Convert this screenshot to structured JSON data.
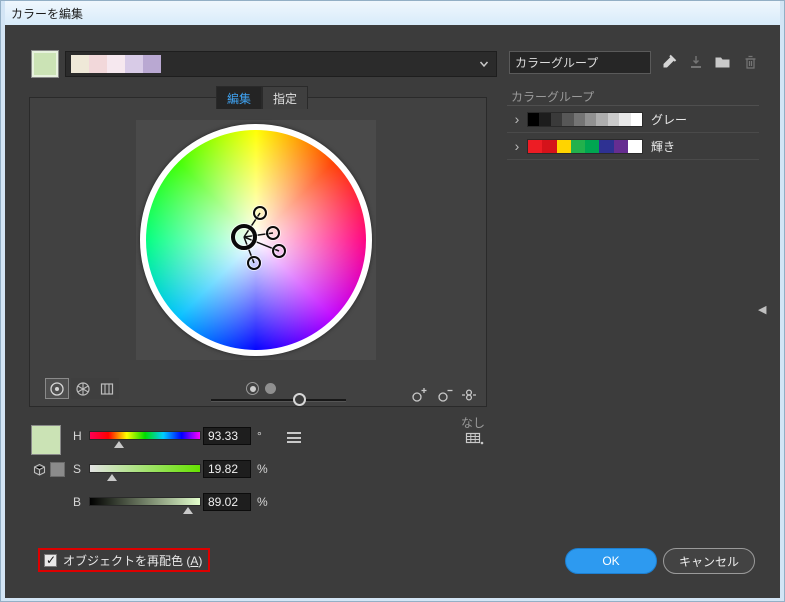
{
  "window": {
    "title": "カラーを編集"
  },
  "top": {
    "base_color": "#cbe3b5",
    "preview_colors": [
      "#efe9d8",
      "#f2d8da",
      "#f6e8ef",
      "#d8cbe7",
      "#b9a8d2"
    ],
    "group_name_value": "カラーグループ"
  },
  "tabs": {
    "edit": "編集",
    "assign": "指定"
  },
  "wheel": {
    "none_label": "なし"
  },
  "hsb": {
    "current_color": "#cbe3b5",
    "small_swatch_color": "#8b8b8b",
    "rows": [
      {
        "label": "H",
        "value": "93.33",
        "unit": "°",
        "max": 360
      },
      {
        "label": "S",
        "value": "19.82",
        "unit": "%",
        "max": 100
      },
      {
        "label": "B",
        "value": "89.02",
        "unit": "%",
        "max": 100
      }
    ]
  },
  "color_groups": {
    "header": "カラーグループ",
    "chevron": "›",
    "groups": [
      {
        "name": "グレー",
        "colors": [
          "#000000",
          "#1d1d1d",
          "#3a3a3a",
          "#575757",
          "#747474",
          "#919191",
          "#aeaeae",
          "#cbcbcb",
          "#e8e8e8",
          "#ffffff"
        ]
      },
      {
        "name": "輝き",
        "colors": [
          "#ed1c24",
          "#d5121a",
          "#ffd400",
          "#22b14c",
          "#00a651",
          "#2e3192",
          "#662d91",
          "#ffffff"
        ]
      }
    ]
  },
  "panel_toggle_icon": "◀",
  "footer": {
    "checkbox_pre": "オブジェクトを再配色 (",
    "checkbox_key": "A",
    "checkbox_post": ")",
    "ok": "OK",
    "cancel": "キャンセル"
  },
  "colors": {
    "accent_blue": "#2d9af0",
    "annotation_red": "#dd0000",
    "active_tab_text": "#3fa3f2"
  }
}
